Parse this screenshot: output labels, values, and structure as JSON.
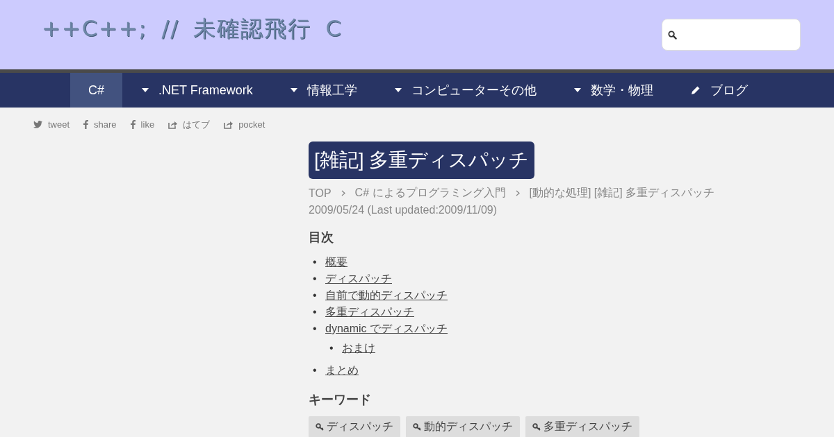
{
  "site_title": "++C++; // 未確認飛行 C",
  "nav": [
    {
      "label": "C#",
      "kind": "plain",
      "selected": true
    },
    {
      "label": ".NET Framework",
      "kind": "caret",
      "selected": false
    },
    {
      "label": "情報工学",
      "kind": "caret",
      "selected": false
    },
    {
      "label": "コンピューターその他",
      "kind": "caret",
      "selected": false
    },
    {
      "label": "数学・物理",
      "kind": "caret",
      "selected": false
    },
    {
      "label": "ブログ",
      "kind": "pencil",
      "selected": false
    }
  ],
  "share": [
    {
      "label": "tweet",
      "kind": "twitter"
    },
    {
      "label": "share",
      "kind": "facebook"
    },
    {
      "label": "like",
      "kind": "facebook"
    },
    {
      "label": "はてブ",
      "kind": "share"
    },
    {
      "label": "pocket",
      "kind": "share"
    }
  ],
  "article": {
    "title": "[雑記] 多重ディスパッチ",
    "breadcrumb": [
      "TOP",
      "C# によるプログラミング入門",
      "[動的な処理] [雑記] 多重ディスパッチ"
    ],
    "date": "2009/05/24 (Last updated:2009/11/09)",
    "toc_heading": "目次",
    "toc": [
      {
        "marker": "•",
        "label": "概要"
      },
      {
        "marker": "•",
        "label": "ディスパッチ"
      },
      {
        "marker": "•",
        "label": "自前で動的ディスパッチ"
      },
      {
        "marker": "•",
        "label": "多重ディスパッチ"
      },
      {
        "marker": "•",
        "label": "dynamic でディスパッチ",
        "children": [
          {
            "marker": "•",
            "label": "おまけ"
          }
        ]
      },
      {
        "marker": "•",
        "label": "まとめ"
      }
    ],
    "keywords_heading": "キーワード",
    "keywords": [
      "ディスパッチ",
      "動的ディスパッチ",
      "多重ディスパッチ"
    ]
  }
}
